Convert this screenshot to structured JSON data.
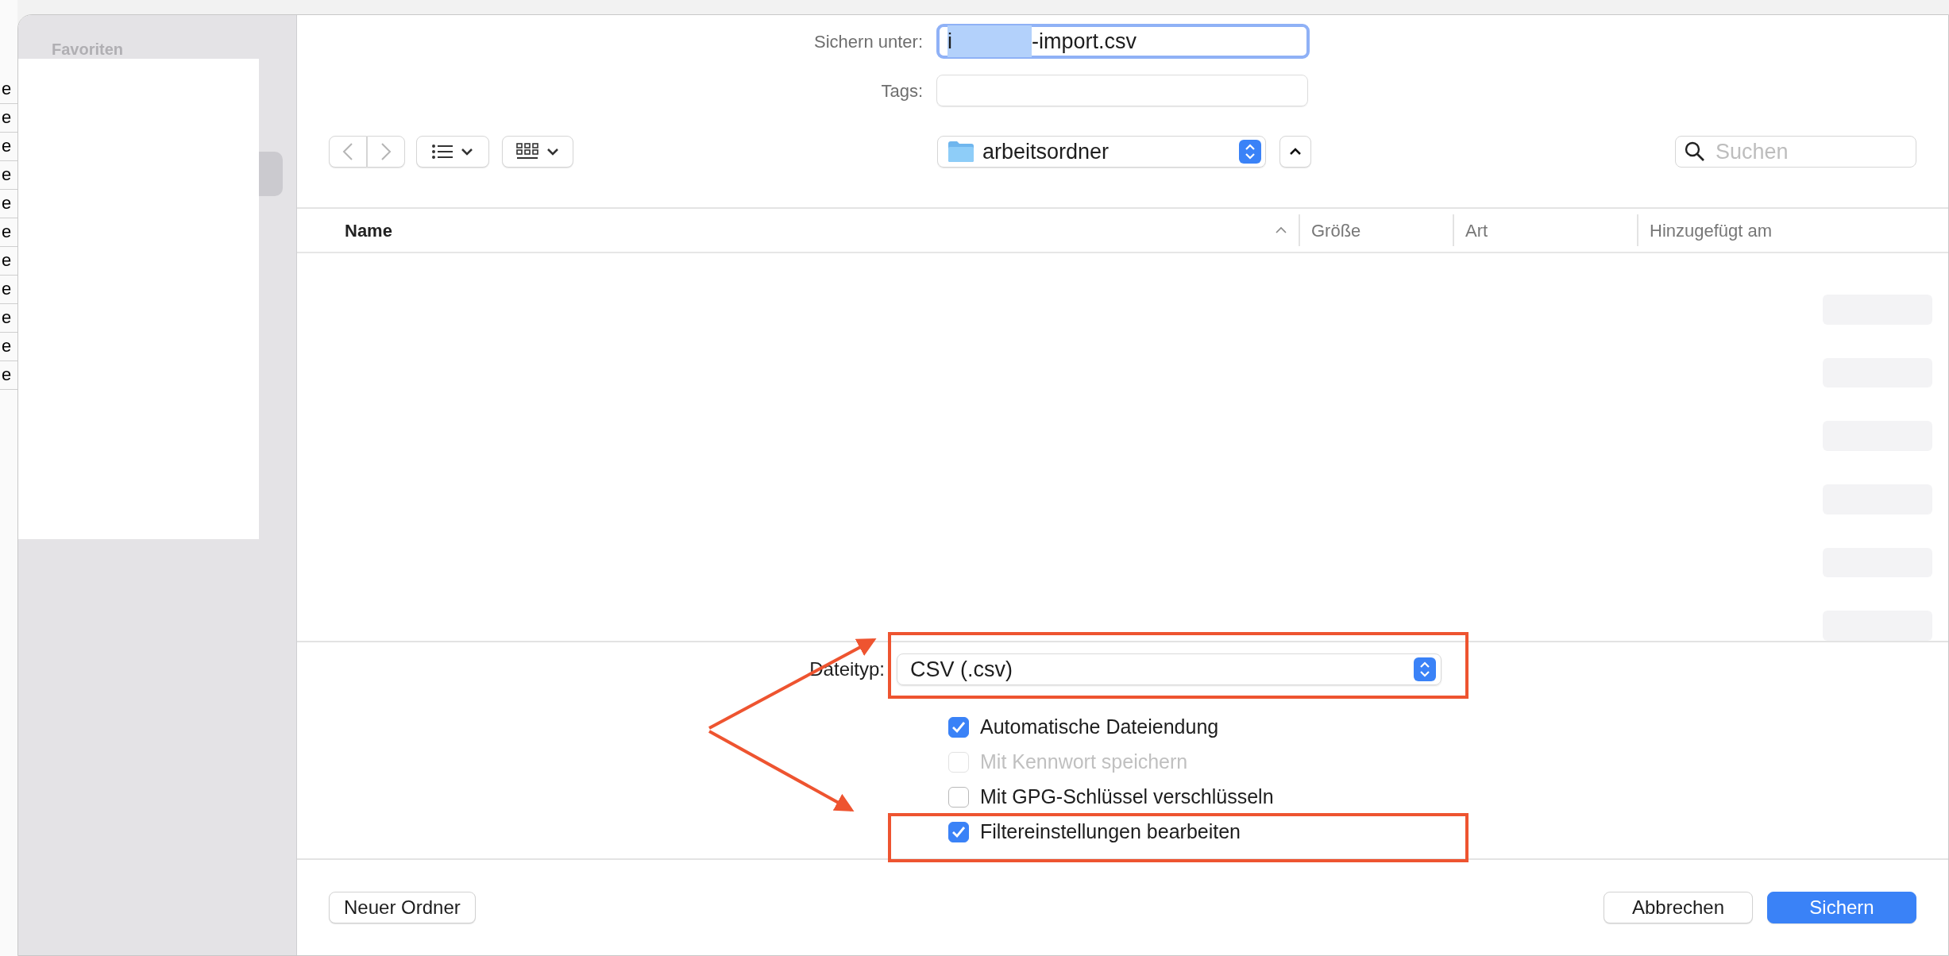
{
  "background_cells": [
    "e",
    "e",
    "e",
    "e",
    "e",
    "e",
    "e",
    "e",
    "e",
    "e",
    "e"
  ],
  "sidebar": {
    "section_title": "Favoriten"
  },
  "save_as": {
    "label": "Sichern unter:",
    "value_start": "i",
    "value_end": "-import.csv"
  },
  "tags": {
    "label": "Tags:"
  },
  "location": {
    "folder": "arbeitsordner"
  },
  "search": {
    "placeholder": "Suchen"
  },
  "columns": [
    {
      "label": "Name",
      "sorted": true
    },
    {
      "label": "Größe",
      "sorted": false
    },
    {
      "label": "Art",
      "sorted": false
    },
    {
      "label": "Hinzugefügt am",
      "sorted": false
    }
  ],
  "file_type": {
    "label": "Dateityp:",
    "value": "CSV (.csv)"
  },
  "options": [
    {
      "label": "Automatische Dateiendung",
      "checked": true,
      "disabled": false
    },
    {
      "label": "Mit Kennwort speichern",
      "checked": false,
      "disabled": true
    },
    {
      "label": "Mit GPG-Schlüssel verschlüsseln",
      "checked": false,
      "disabled": false
    },
    {
      "label": "Filtereinstellungen bearbeiten",
      "checked": true,
      "disabled": false
    }
  ],
  "footer": {
    "left": [
      {
        "label": "Neuer Ordner",
        "kind": "default"
      }
    ],
    "right": [
      {
        "label": "Abbrechen",
        "kind": "default"
      },
      {
        "label": "Sichern",
        "kind": "primary"
      }
    ]
  }
}
